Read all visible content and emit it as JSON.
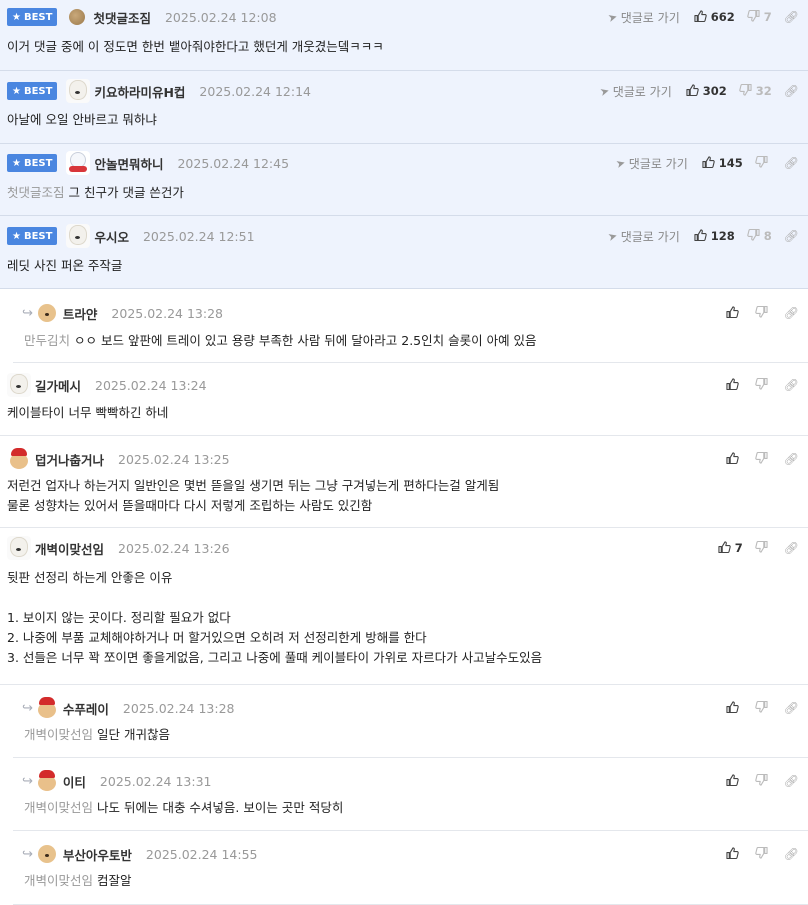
{
  "ui": {
    "best_label": "BEST",
    "goto_label": "댓글로 가기",
    "accent_color": "#4a86e0"
  },
  "comments": [
    {
      "best": true,
      "nick": "첫댓글조짐",
      "avatar": "coin-avatar",
      "date": "2025.02.24 12:08",
      "up": "662",
      "down": "7",
      "mention": "",
      "text": "이거 댓글 중에 이 정도면 한번 뱉아줘야한다고 했던게 개웃겼는뎈ㅋㅋㅋ"
    },
    {
      "best": true,
      "nick": "키요하라미유H컵",
      "avatar": "white-dog-avatar",
      "date": "2025.02.24 12:14",
      "up": "302",
      "down": "32",
      "mention": "",
      "text": "아날에 오일 안바르고 뭐하냐"
    },
    {
      "best": true,
      "nick": "안놀면뭐하니",
      "avatar": "snowman-avatar",
      "date": "2025.02.24 12:45",
      "up": "145",
      "down": "",
      "mention": "첫댓글조짐",
      "text": "그 친구가 댓글 쓴건가"
    },
    {
      "best": true,
      "nick": "우시오",
      "avatar": "white-dog-avatar",
      "date": "2025.02.24 12:51",
      "up": "128",
      "down": "8",
      "mention": "",
      "text": "레딧 사진 퍼온 주작글"
    },
    {
      "best": false,
      "reply": true,
      "nick": "트라얀",
      "avatar": "puppy-avatar",
      "date": "2025.02.24 13:28",
      "up": "",
      "down": "",
      "mention": "만두김치",
      "text": "ㅇㅇ 보드 앞판에 트레이 있고 용량 부족한 사람 뒤에 달아라고 2.5인치 슬롯이 아예 있음"
    },
    {
      "best": false,
      "reply": false,
      "nick": "길가메시",
      "avatar": "white-dog-avatar",
      "date": "2025.02.24 13:24",
      "up": "",
      "down": "",
      "mention": "",
      "text": "케이블타이 너무 빡빡하긴 하네"
    },
    {
      "best": false,
      "reply": false,
      "nick": "덥거나춥거나",
      "avatar": "santa-avatar",
      "date": "2025.02.24 13:25",
      "up": "",
      "down": "",
      "mention": "",
      "text": "저런건 업자나 하는거지 일반인은 몇번 뜯을일 생기면 뒤는 그냥 구겨넣는게 편하다는걸 알게됨\n물론 성향차는 있어서 뜯을때마다 다시 저렇게 조립하는 사람도 있긴함"
    },
    {
      "best": false,
      "reply": false,
      "nick": "개벽이맞선임",
      "avatar": "white-dog-avatar",
      "date": "2025.02.24 13:26",
      "up": "7",
      "down": "",
      "mention": "",
      "text": "뒷판 선정리 하는게 안좋은 이유\n\n1. 보이지 않는 곳이다. 정리할 필요가 없다\n2. 나중에 부품 교체해야하거나 머 할거있으면 오히려 저 선정리한게 방해를 한다\n3. 선들은 너무 꽉 쪼이면 좋을게없음, 그리고 나중에 풀때 케이블타이 가위로 자르다가 사고날수도있음"
    },
    {
      "best": false,
      "reply": true,
      "nick": "수푸레이",
      "avatar": "puppy-cape-avatar",
      "date": "2025.02.24 13:28",
      "up": "",
      "down": "",
      "mention": "개벽이맞선임",
      "text": "일단 개귀찮음"
    },
    {
      "best": false,
      "reply": true,
      "nick": "이티",
      "avatar": "puppy-cape-avatar",
      "date": "2025.02.24 13:31",
      "up": "",
      "down": "",
      "mention": "개벽이맞선임",
      "text": "나도 뒤에는 대충 수셔넣음. 보이는 곳만 적당히"
    },
    {
      "best": false,
      "reply": true,
      "nick": "부산아우토반",
      "avatar": "puppy-avatar",
      "date": "2025.02.24 14:55",
      "up": "",
      "down": "",
      "mention": "개벽이맞선임",
      "text": "컴잘알"
    }
  ]
}
